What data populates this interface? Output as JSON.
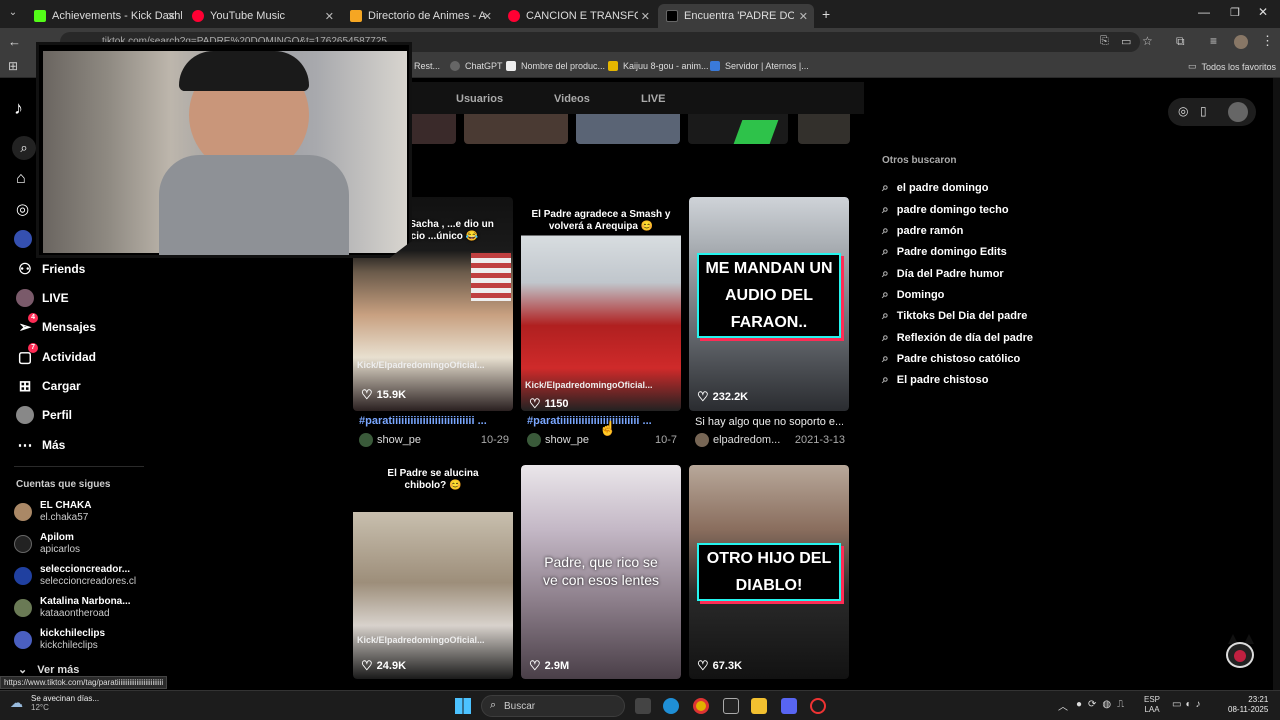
{
  "tabs": [
    {
      "title": "Achievements - Kick Dashboard",
      "color": "#53fc18"
    },
    {
      "title": "YouTube Music",
      "color": "#ff0033"
    },
    {
      "title": "Directorio de Animes - AnimeFL",
      "color": "#f5a623"
    },
    {
      "title": "CANCION E TRANSFORMACIO",
      "color": "#ff0033"
    },
    {
      "title": "Encuentra 'PADRE DOMINGO' e",
      "color": "#000000"
    }
  ],
  "toolbar": {
    "url": "tiktok.com/search?q=PADRE%20DOMINGO&t=1762654587725"
  },
  "bookmarks": {
    "items": [
      "Rest...",
      "ChatGPT",
      "Nombre del produc...",
      "Kaijuu 8-gou - anim...",
      "Servidor | Aternos |..."
    ],
    "all": "Todos los favoritos"
  },
  "search_tabs": [
    "Usuarios",
    "Videos",
    "LIVE"
  ],
  "sidebar": {
    "items": [
      {
        "label": "Friends",
        "icon": "friends-icon"
      },
      {
        "label": "LIVE",
        "icon": "live-icon"
      },
      {
        "label": "Mensajes",
        "icon": "messages-icon",
        "badge": "4"
      },
      {
        "label": "Actividad",
        "icon": "activity-icon",
        "badge": "7"
      },
      {
        "label": "Cargar",
        "icon": "upload-icon"
      },
      {
        "label": "Perfil",
        "icon": "profile-icon"
      },
      {
        "label": "Más",
        "icon": "more-icon"
      }
    ],
    "following_title": "Cuentas que sigues",
    "following": [
      {
        "name": "EL CHAKA",
        "handle": "el.chaka57"
      },
      {
        "name": "Apilom",
        "handle": "apicarlos"
      },
      {
        "name": "seleccioncreador...",
        "handle": "seleccioncreadores.cl"
      },
      {
        "name": "Katalina Narbona...",
        "handle": "kataaontheroad"
      },
      {
        "name": "kickchileclips",
        "handle": "kickchileclips"
      }
    ],
    "see_more": "Ver más"
  },
  "videos": [
    {
      "top_caption": "...isto y Sacha , ...e dio un espacio ...único 😂",
      "kick": "Kick/ElpadredomingoOficial...",
      "likes": "15.9K",
      "desc": "#paratiiiiiiiiiiiiiiiiiiiiiiiiiii ...",
      "user": "show_pe",
      "date": "10-29"
    },
    {
      "top_caption": "El Padre agradece a Smash y volverá a Arequipa 😊",
      "kick": "Kick/ElpadredomingoOficial...",
      "likes": "1150",
      "desc": "#paratiiiiiiiiiiiiiiiiiiiiiiiiii ...",
      "user": "show_pe",
      "date": "10-7"
    },
    {
      "overlay": "ME MANDAN UN AUDIO DEL FARAON..",
      "likes": "232.2K",
      "desc": "Si hay algo que no soporto e...",
      "user": "elpadredom...",
      "date": "2021-3-13"
    },
    {
      "top_caption": "El Padre se alucina chibolo? 😊",
      "kick": "Kick/ElpadredomingoOficial...",
      "likes": "24.9K"
    },
    {
      "overlay_plain": "Padre, que rico se ve con esos lentes",
      "likes": "2.9M"
    },
    {
      "overlay": "OTRO HIJO DEL DIABLO!",
      "likes": "67.3K"
    }
  ],
  "others": {
    "title": "Otros buscaron",
    "items": [
      "el padre domingo",
      "padre domingo techo",
      "padre ramón",
      "Padre domingo Edits",
      "Día del Padre humor",
      "Domingo",
      "Tiktoks Del Dia del padre",
      "Reflexión de día del padre",
      "Padre chistoso católico",
      "El padre chistoso"
    ]
  },
  "status_link": "https://www.tiktok.com/tag/paratiiiiiiiiiiiiiiiiiiiiiiiiii",
  "taskbar": {
    "weather_title": "Se avecinan días...",
    "weather_temp": "12°C",
    "search_placeholder": "Buscar",
    "lang": "ESP",
    "lang2": "LAA",
    "time": "23:21",
    "date": "08-11-2025"
  }
}
